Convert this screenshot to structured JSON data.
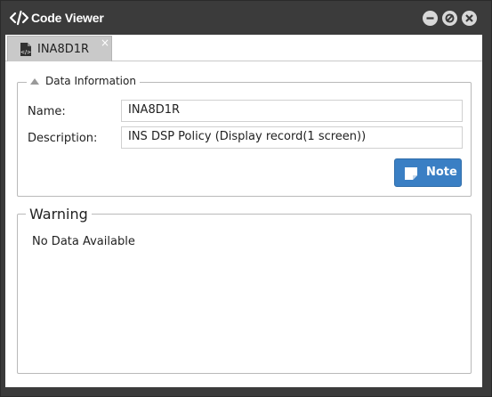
{
  "window": {
    "title": "Code Viewer",
    "title_icon": "code-icon",
    "controls": [
      "minimize-icon",
      "maximize-icon",
      "close-icon"
    ]
  },
  "tabs": [
    {
      "label": "INA8D1R",
      "icon": "file-code-icon",
      "close": "×"
    }
  ],
  "data_information": {
    "legend": "Data Information",
    "fields": [
      {
        "label": "Name:",
        "value": "INA8D1R"
      },
      {
        "label": "Description:",
        "value": "INS DSP Policy (Display record(1 screen))"
      }
    ],
    "note_button": {
      "label": "Note",
      "icon": "note-icon"
    }
  },
  "warning": {
    "legend": "Warning",
    "message": "No Data Available"
  },
  "colors": {
    "titlebar": "#3b3b3b",
    "accent": "#3a7fc4",
    "tab_bg": "#c9c9c9"
  }
}
